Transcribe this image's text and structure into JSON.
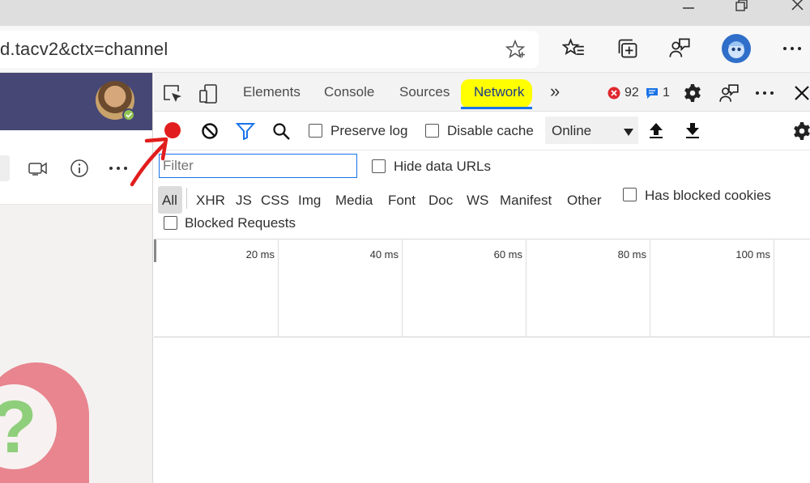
{
  "browser": {
    "url": "d.tacv2&ctx=channel",
    "window_controls": [
      "minimize-icon",
      "restore-icon",
      "close-icon"
    ],
    "toolbar_icons": [
      "star-icon",
      "favorites-icon",
      "collections-icon",
      "feedback-icon",
      "profile-avatar-icon",
      "more-icon"
    ]
  },
  "teams": {
    "toolbar_icons": [
      "meet-now-icon",
      "info-icon",
      "more-icon"
    ],
    "help_glyph": "?"
  },
  "devtools": {
    "tabs": [
      {
        "label": "Elements",
        "active": false
      },
      {
        "label": "Console",
        "active": false
      },
      {
        "label": "Sources",
        "active": false
      },
      {
        "label": "Network",
        "active": true
      }
    ],
    "more_tabs_glyph": "»",
    "error_count": "92",
    "message_count": "1",
    "toolbar": {
      "preserve_log": "Preserve log",
      "disable_cache": "Disable cache",
      "throttling": "Online"
    },
    "filter": {
      "placeholder": "Filter",
      "hide_data_urls": "Hide data URLs",
      "types": [
        "All",
        "XHR",
        "JS",
        "CSS",
        "Img",
        "Media",
        "Font",
        "Doc",
        "WS",
        "Manifest",
        "Other"
      ],
      "has_blocked_cookies": "Has blocked cookies",
      "blocked_requests": "Blocked Requests"
    },
    "timeline_ticks": [
      "20 ms",
      "40 ms",
      "60 ms",
      "80 ms",
      "100 ms"
    ]
  },
  "colors": {
    "record": "#e21d1d",
    "highlight": "#ffff00",
    "accent": "#1a73e8",
    "teams_purple": "#464775",
    "annotation_arrow": "#e21d1d"
  }
}
